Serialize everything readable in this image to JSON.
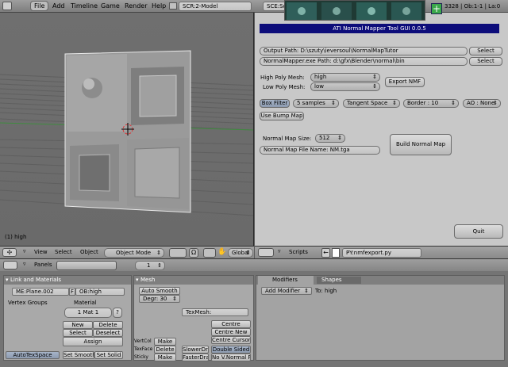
{
  "topbar": {
    "menus": [
      "File",
      "Add",
      "Timeline",
      "Game",
      "Render",
      "Help"
    ],
    "screen": "SCR:2-Model",
    "scene": "SCE:Sc",
    "stats": "3328 | Ob:1-1 | La:0"
  },
  "viewport": {
    "object_label": "(1) high",
    "header": {
      "menus": [
        "View",
        "Select",
        "Object"
      ],
      "mode": "Object Mode",
      "orientation": "Global"
    }
  },
  "script_panel": {
    "title": "ATI Normal Mapper Tool GUI 0.0.5",
    "output_path": "Output Path: D:\\szuty\\ieversoul\\NormalMapTutor",
    "exe_path": "NormalMapper.exe Path: d:\\gfx\\Blender\\normal\\bin",
    "select_label": "Select",
    "high_poly_label": "High Poly Mesh:",
    "high_poly_value": "high",
    "low_poly_label": "Low Poly Mesh:",
    "low_poly_value": "low",
    "export_label": "Export NMF",
    "box_filter": "Box Filter",
    "samples": "5 samples",
    "tangent": "Tangent Space",
    "border": "Border : 10",
    "ao": "AO : None",
    "bump": "Use Bump Map",
    "map_size_label": "Normal Map Size:",
    "map_size_value": "512",
    "file_name": "Normal Map File Name: NM.tga",
    "build": "Build Normal Map",
    "quit": "Quit"
  },
  "script_header": {
    "menu": "Scripts",
    "file": "PY:nmfexport.py"
  },
  "buttons_header": {
    "panels_label": "Panels",
    "frame": "1"
  },
  "link_panel": {
    "title": "Link and Materials",
    "me_field": "ME:Plane.002",
    "f_label": "F",
    "ob_field": "OB:high",
    "vertex_groups": "Vertex Groups",
    "material_label": "Material",
    "mat_value": "1 Mat 1",
    "q": "?",
    "new_vg": "New",
    "delete_vg": "Delete",
    "select_vg": "Select",
    "deselect_vg": "Deselect",
    "assign": "Assign",
    "autotex": "AutoTexSpace",
    "set_smooth": "Set Smooth",
    "set_solid": "Set Solid"
  },
  "mesh_panel": {
    "title": "Mesh",
    "auto_smooth": "Auto Smooth",
    "degr": "Degr: 30",
    "texmesh": "TexMesh:",
    "centre": "Centre",
    "centre_new": "Centre New",
    "centre_cursor": "Centre Cursor",
    "vertcol": "VertCol",
    "texface": "TexFace",
    "sticky": "Sticky",
    "make": "Make",
    "delete": "Delete",
    "slower": "SlowerDra",
    "faster": "FasterDra",
    "double_sided": "Double Sided",
    "no_v_normal": "No V.Normal Fli"
  },
  "modifiers_panel": {
    "tab_modifiers": "Modifiers",
    "tab_shapes": "Shapes",
    "add_modifier": "Add Modifier",
    "to_label": "To: high"
  }
}
